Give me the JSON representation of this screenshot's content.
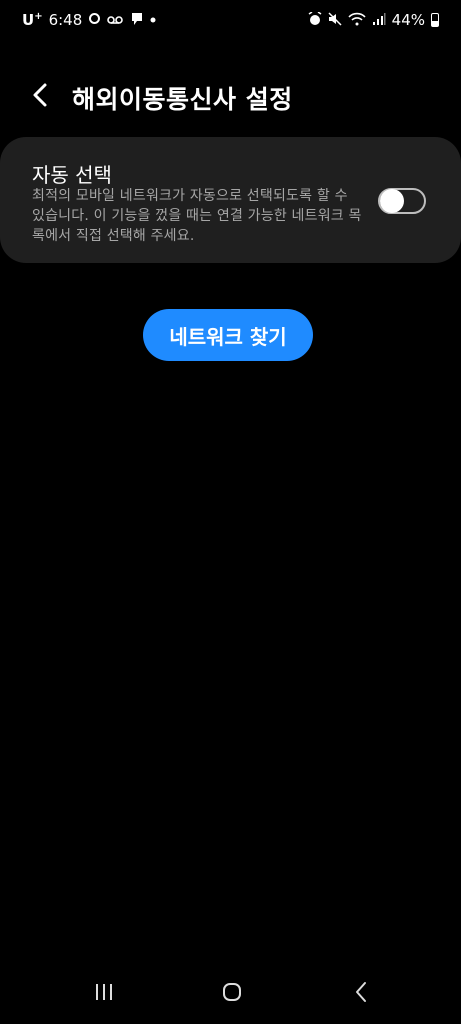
{
  "status_bar": {
    "carrier": "U",
    "carrier_plus": "+",
    "time": "6:48",
    "battery": "44%",
    "battery_level": 0.44,
    "icons": [
      "sync-icon",
      "voicemail-icon",
      "message-icon",
      "dot-icon",
      "alarm-icon",
      "mute-icon",
      "wifi-icon",
      "signal-icon",
      "battery-icon"
    ]
  },
  "header": {
    "title": "해외이동통신사 설정"
  },
  "auto_select": {
    "title": "자동 선택",
    "description": "최적의 모바일 네트워크가 자동으로 선택되도록 할 수 있습니다. 이 기능을 껐을 때는 연결 가능한 네트워크 목록에서 직접 선택해 주세요.",
    "toggle_on": false
  },
  "find_network_button": "네트워크 찾기",
  "colors": {
    "background": "#000000",
    "card": "#1f1f1f",
    "accent": "#1f8bff",
    "secondary_text": "#a6a6a6"
  },
  "navbar": {
    "icons": [
      "recent-apps-icon",
      "home-icon",
      "back-icon"
    ]
  }
}
